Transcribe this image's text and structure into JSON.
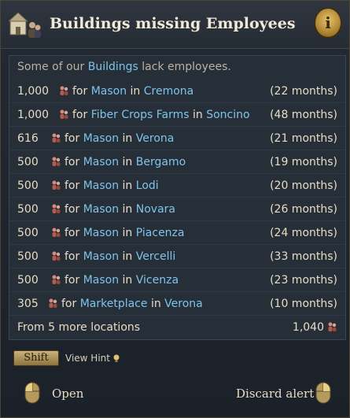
{
  "header": {
    "title": "Buildings missing Employees",
    "icon": "buildings-workers-icon",
    "info_icon": "info-icon",
    "info_glyph": "i"
  },
  "intro": {
    "prefix": "Some of our ",
    "link": "Buildings",
    "suffix": " lack employees."
  },
  "rows": [
    {
      "amount": "1,000",
      "for": "for",
      "building": "Mason",
      "in": "in",
      "town": "Cremona",
      "duration": "(22 months)"
    },
    {
      "amount": "1,000",
      "for": "for",
      "building": "Fiber Crops Farms",
      "in": "in",
      "town": "Soncino",
      "duration": "(48 months)"
    },
    {
      "amount": "616",
      "for": "for",
      "building": "Mason",
      "in": "in",
      "town": "Verona",
      "duration": "(21 months)"
    },
    {
      "amount": "500",
      "for": "for",
      "building": "Mason",
      "in": "in",
      "town": "Bergamo",
      "duration": "(19 months)"
    },
    {
      "amount": "500",
      "for": "for",
      "building": "Mason",
      "in": "in",
      "town": "Lodi",
      "duration": "(20 months)"
    },
    {
      "amount": "500",
      "for": "for",
      "building": "Mason",
      "in": "in",
      "town": "Novara",
      "duration": "(26 months)"
    },
    {
      "amount": "500",
      "for": "for",
      "building": "Mason",
      "in": "in",
      "town": "Piacenza",
      "duration": "(24 months)"
    },
    {
      "amount": "500",
      "for": "for",
      "building": "Mason",
      "in": "in",
      "town": "Vercelli",
      "duration": "(33 months)"
    },
    {
      "amount": "500",
      "for": "for",
      "building": "Mason",
      "in": "in",
      "town": "Vicenza",
      "duration": "(23 months)"
    },
    {
      "amount": "305",
      "for": "for",
      "building": "Marketplace",
      "in": "in",
      "town": "Verona",
      "duration": "(10 months)"
    }
  ],
  "more": {
    "label": "From 5 more locations",
    "value": "1,040"
  },
  "footer": {
    "shift_key": "Shift",
    "view_hint": "View Hint",
    "open_label": "Open",
    "discard_label": "Discard alert"
  },
  "colors": {
    "link": "#7fc3ea",
    "text": "#e8dcc4",
    "gold": "#c9a04a"
  }
}
